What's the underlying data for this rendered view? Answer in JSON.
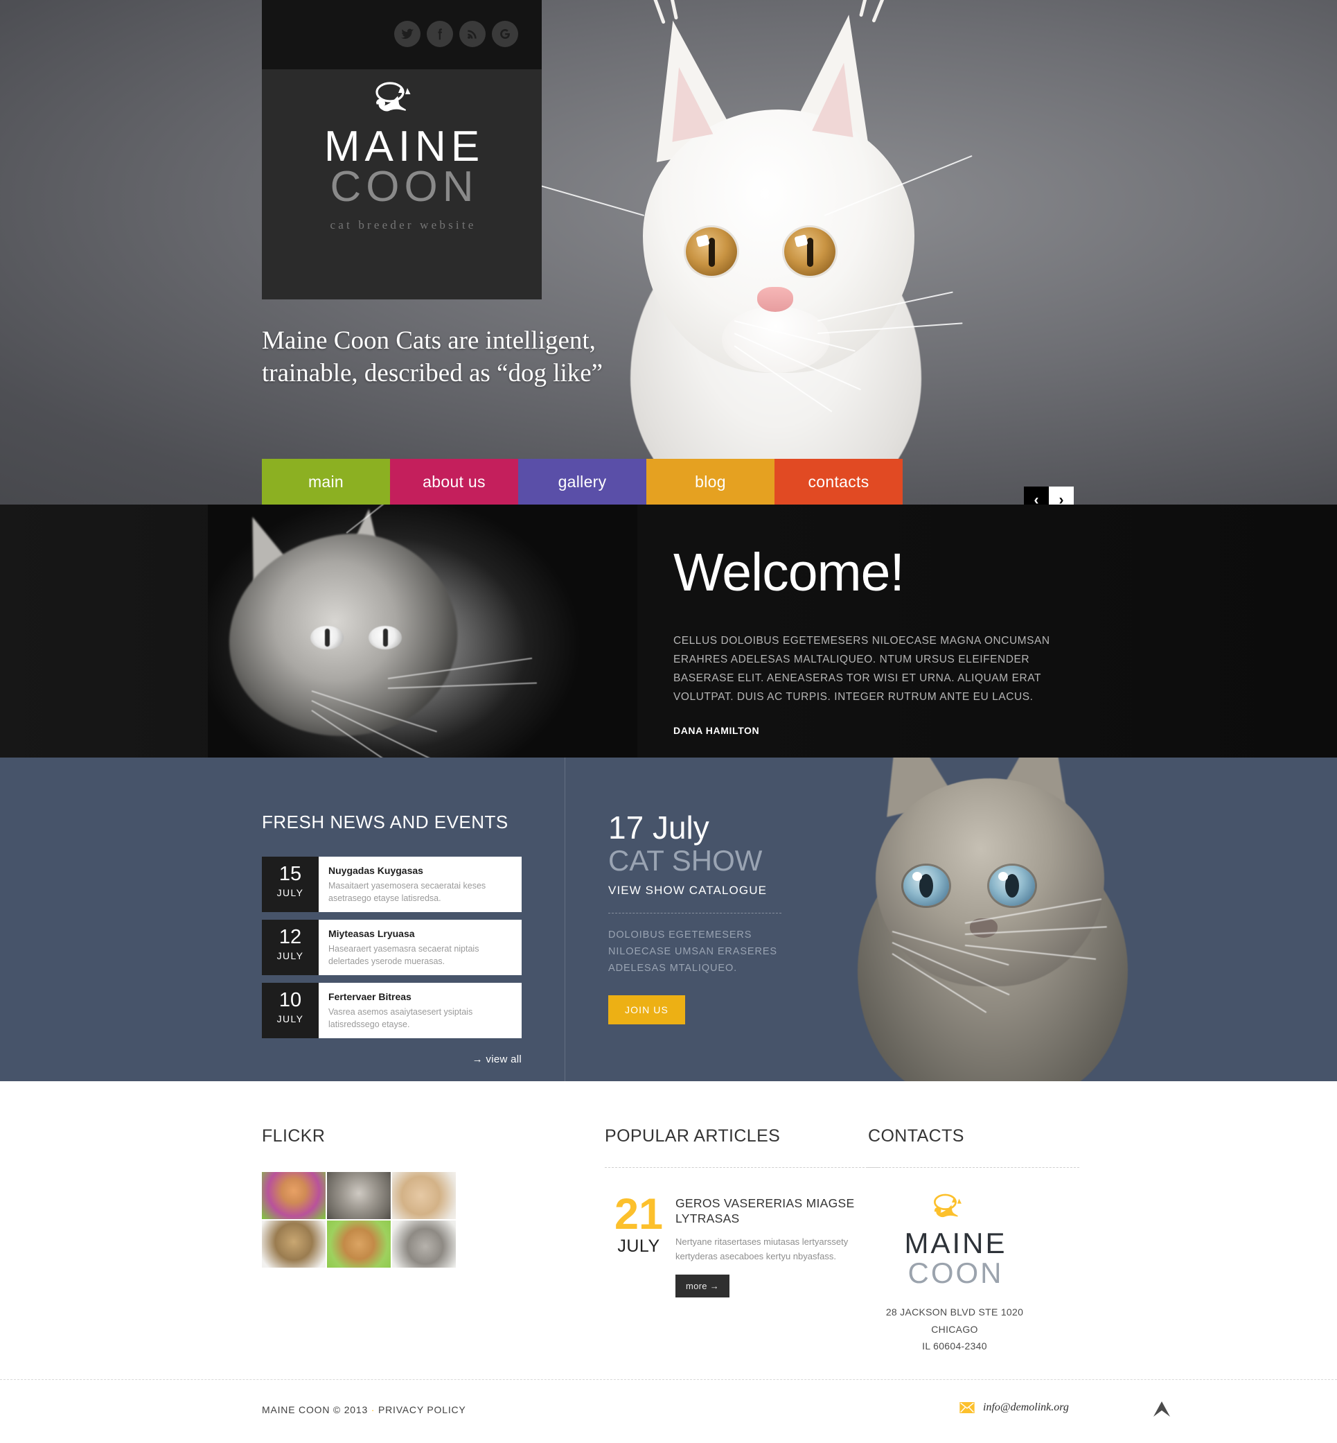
{
  "brand": {
    "logo_line1": "MAINE",
    "logo_line2": "COON",
    "tagline": "cat breeder website",
    "cat_icon": "cat-silhouette-icon"
  },
  "social": [
    {
      "name": "twitter-icon",
      "label": "Twitter"
    },
    {
      "name": "facebook-icon",
      "label": "Facebook"
    },
    {
      "name": "rss-icon",
      "label": "RSS"
    },
    {
      "name": "googleplus-icon",
      "label": "Google Plus"
    }
  ],
  "hero": {
    "tagline": "Maine Coon Cats are intelligent, trainable, described as “dog like”",
    "prev_label": "‹",
    "next_label": "›"
  },
  "nav": {
    "items": [
      {
        "label": "main",
        "color": "#8cb022"
      },
      {
        "label": "about us",
        "color": "#c41f5c"
      },
      {
        "label": "gallery",
        "color": "#5a4fa8"
      },
      {
        "label": "blog",
        "color": "#e5a121"
      },
      {
        "label": "contacts",
        "color": "#e14a23"
      }
    ]
  },
  "welcome": {
    "title": "Welcome!",
    "body": "CELLUS DOLOIBUS EGETEMESERS NILOECASE MAGNA ONCUMSAN ERAHRES ADELESAS MALTALIQUEO. NTUM URSUS ELEIFENDER BASERASE ELIT. AENEASERAS TOR WISI ET URNA. ALIQUAM ERAT VOLUTPAT. DUIS AC TURPIS. INTEGER RUTRUM ANTE EU LACUS.",
    "author": "DANA HAMILTON"
  },
  "news": {
    "heading": "FRESH NEWS AND EVENTS",
    "items": [
      {
        "day": "15",
        "month": "JULY",
        "title": "Nuygadas Kuygasas",
        "desc": "Masaitaert yasemosera secaeratai keses asetrasego etayse latisredsa."
      },
      {
        "day": "12",
        "month": "JULY",
        "title": "Miyteasas Lryuasa",
        "desc": "Hasearaert yasemasra secaerat niptais delertades yserode muerasas."
      },
      {
        "day": "10",
        "month": "JULY",
        "title": "Fertervaer Bitreas",
        "desc": "Vasrea asemos asaiytasesert ysiptais latisredssego etayse."
      }
    ],
    "view_all": "→ view all"
  },
  "catshow": {
    "date": "17 July",
    "title": "CAT SHOW",
    "catalogue": "VIEW SHOW CATALOGUE",
    "desc": "DOLOIBUS EGETEMESERS NILOECASE UMSAN ERASERES ADELESAS MTALIQUEO.",
    "button": "JOIN US",
    "button_color": "#edb014"
  },
  "flickr": {
    "heading": "FLICKR",
    "thumbs": [
      {
        "name": "flickr-thumb-orange-kitten-grass"
      },
      {
        "name": "flickr-thumb-gray-fluffy-kitten"
      },
      {
        "name": "flickr-thumb-cream-persian-cat"
      },
      {
        "name": "flickr-thumb-tabby-cat-portrait"
      },
      {
        "name": "flickr-thumb-ginger-cat-green-bg"
      },
      {
        "name": "flickr-thumb-gray-kitten-lying"
      }
    ]
  },
  "articles": {
    "heading": "POPULAR ARTICLES",
    "items": [
      {
        "day": "21",
        "month": "JULY",
        "title": "GEROS VASERERIAS MIAGSE LYTRASAS",
        "desc": "Nertyane ritasertases miutasas lertyarssety kertyderas asecaboes kertyu nbyasfass.",
        "more": "more  →"
      }
    ]
  },
  "contacts": {
    "heading": "CONTACTS",
    "logo_line1": "MAINE",
    "logo_line2": "COON",
    "address_line1": "28 JACKSON BLVD STE 1020",
    "address_line2": "CHICAGO",
    "address_line3": "IL 60604-2340"
  },
  "footer": {
    "copyright": "MAINE COON © 2013",
    "separator": "·",
    "privacy": "PRIVACY POLICY",
    "email": "info@demolink.org",
    "email_icon": "envelope-icon",
    "back_to_top_icon": "chevron-up-icon"
  },
  "colors": {
    "accent_yellow": "#fcc02c",
    "midband_bg": "#47546a",
    "welcome_bg": "#111111"
  }
}
